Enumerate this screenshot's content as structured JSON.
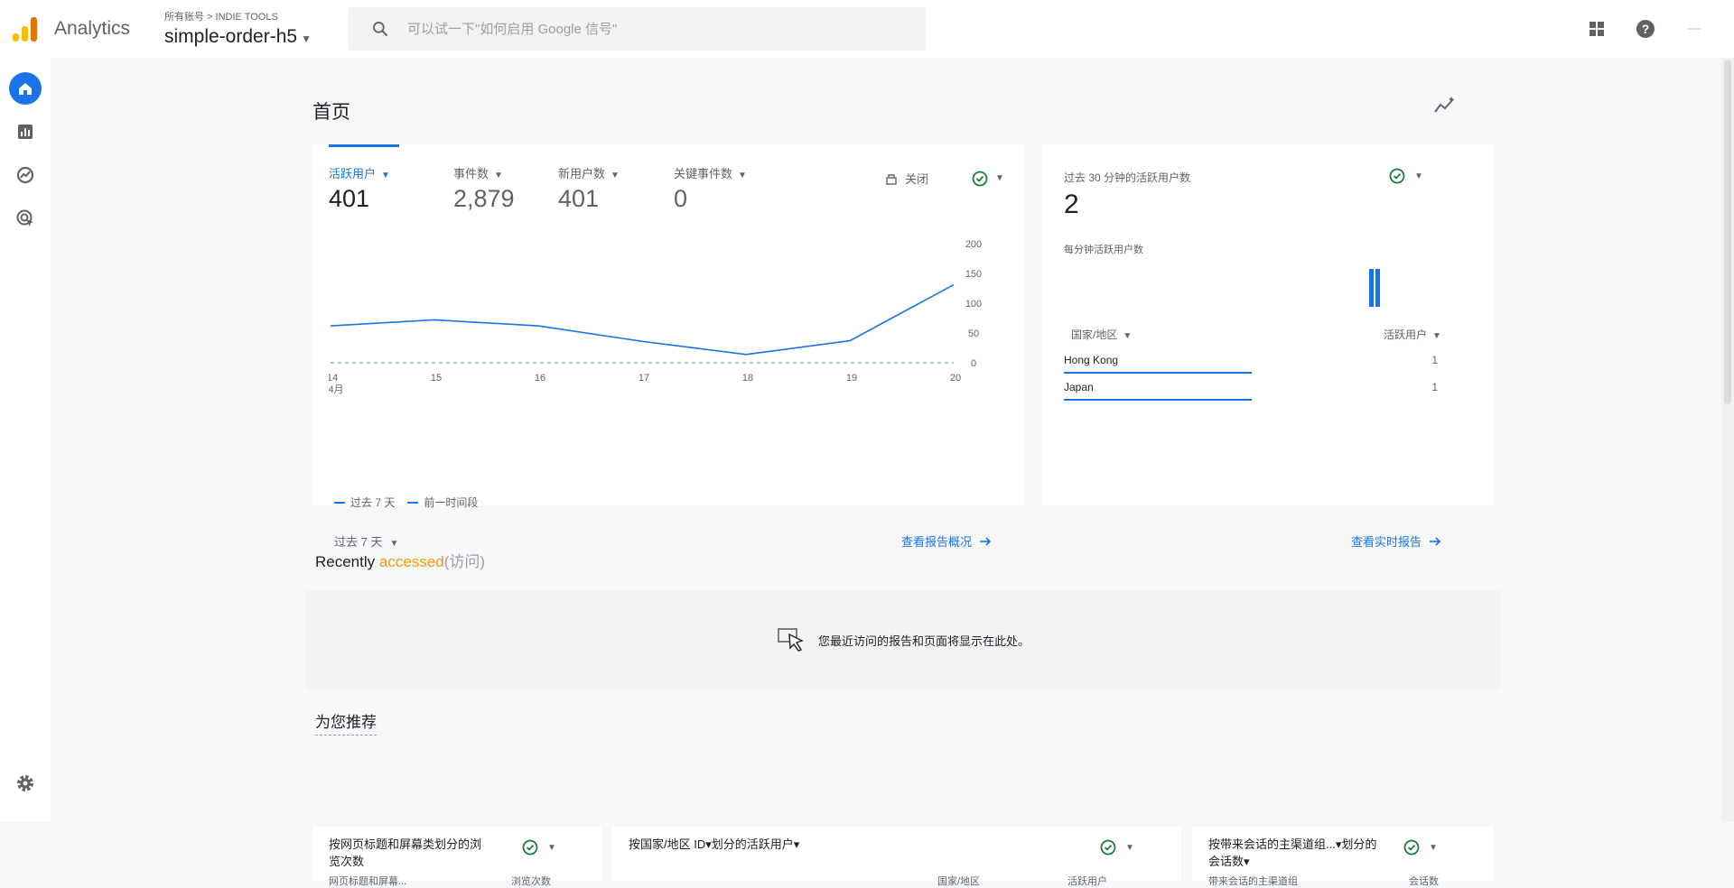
{
  "app": {
    "name": "Analytics",
    "breadcrumb": "所有账号 > INDIE TOOLS",
    "property": "simple-order-h5",
    "search_placeholder": "可以试一下\"如何启用 Google 信号\"",
    "colors": {
      "accent": "#1a73e8",
      "logo_light": "#fbbc04",
      "logo_dark": "#e37400",
      "highlight": "#f29900"
    },
    "top_icons": [
      "apps-icon",
      "help-icon",
      "account-icon"
    ]
  },
  "rail": [
    "home-icon",
    "reports-icon",
    "explore-icon",
    "advertising-icon",
    "settings-icon"
  ],
  "page": {
    "title": "首页"
  },
  "overview": {
    "metrics": [
      {
        "label": "活跃用户",
        "value": "401"
      },
      {
        "label": "事件数",
        "value": "2,879"
      },
      {
        "label": "新用户数",
        "value": "401"
      },
      {
        "label": "关键事件数",
        "value": "0"
      }
    ],
    "compare_label": "关闭",
    "range": "过去 7 天",
    "link": "查看报告概况"
  },
  "chart_data": {
    "type": "line",
    "x": [
      "14",
      "15",
      "16",
      "17",
      "18",
      "19",
      "20"
    ],
    "x_sub": "4月",
    "series": [
      {
        "name": "过去 7 天",
        "values": [
          62,
          72,
          62,
          36,
          14,
          37,
          131
        ],
        "style": "solid"
      },
      {
        "name": "前一时间段",
        "values": [
          0,
          0,
          0,
          0,
          0,
          0,
          0
        ],
        "style": "dashed"
      }
    ],
    "yticks": [
      "0",
      "50",
      "100",
      "150",
      "200"
    ],
    "ylim": [
      0,
      200
    ],
    "axis_position": "right",
    "color": "#1a73e8"
  },
  "realtime": {
    "title": "过去 30 分钟的活跃用户数",
    "value": "2",
    "subtitle": "每分钟活跃用户数",
    "col_country": "国家/地区",
    "col_users": "活跃用户",
    "rows": [
      {
        "country": "Hong Kong",
        "users": "1"
      },
      {
        "country": "Japan",
        "users": "1"
      }
    ],
    "link": "查看实时报告"
  },
  "recent": {
    "title_prefix": "Recently ",
    "title_highlight": "accessed",
    "title_suffix": "(访问)",
    "empty": "您最近访问的报告和页面将显示在此处。"
  },
  "recommend": {
    "title": "为您推荐",
    "cards": [
      {
        "title": "按网页标题和屏幕类划分的浏览次数",
        "col_a": "网页标题和屏幕...",
        "col_b": "浏览次数"
      },
      {
        "title": "按国家/地区 ID▾划分的活跃用户▾",
        "col_a": "国家/地区",
        "col_b": "活跃用户"
      },
      {
        "title": "按带来会话的主渠道组...▾划分的会话数▾",
        "col_a": "带来会话的主渠道组",
        "col_b": "会话数"
      }
    ]
  }
}
